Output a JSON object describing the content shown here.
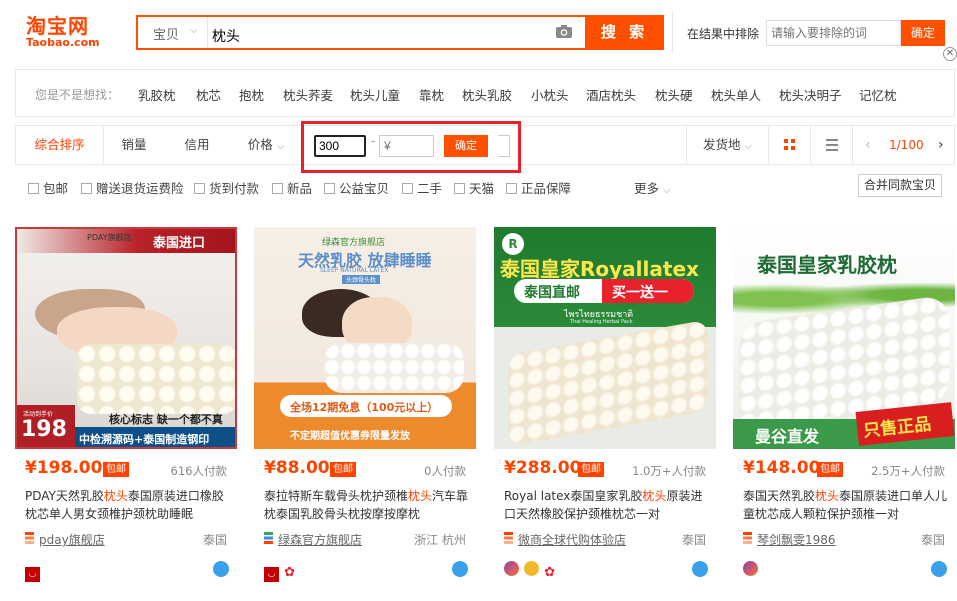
{
  "header": {
    "logo_cn": "淘宝网",
    "logo_en": "Taobao.com",
    "search_type": "宝贝",
    "search_query": "枕头",
    "search_button": "搜 索",
    "exclude_label": "在结果中排除",
    "exclude_placeholder": "请输入要排除的词",
    "exclude_button": "确定"
  },
  "suggestions": {
    "label": "您是不是想找：",
    "items": [
      "乳胶枕",
      "枕芯",
      "抱枕",
      "枕头荞麦",
      "枕头儿童",
      "靠枕",
      "枕头乳胶",
      "小枕头",
      "酒店枕头",
      "枕头硬",
      "枕头单人",
      "枕头决明子",
      "记忆枕"
    ]
  },
  "filter": {
    "sort_tabs": [
      "综合排序",
      "销量",
      "信用",
      "价格"
    ],
    "price_min": "300",
    "price_sep": "-",
    "price_max_placeholder": "¥",
    "price_confirm": "确定",
    "ship_from": "发货地",
    "page": "1/100",
    "checkboxes": [
      "包邮",
      "赠送退货运费险",
      "货到付款",
      "新品",
      "公益宝贝",
      "二手",
      "天猫",
      "正品保障"
    ],
    "more": "更多",
    "merge": "合并同款宝贝"
  },
  "colors": {
    "accent": "#ff4400",
    "brand": "#ff5000",
    "highlight": "#e8222c"
  },
  "products": [
    {
      "price": "¥198.00",
      "baoyou": "包邮",
      "sold": "616人付款",
      "title_pre": "PDAY天然乳胶",
      "title_hl": "枕头",
      "title_post": "泰国原装进口橡胶枕芯单人男女颈椎护颈枕助睡眠",
      "shop": "pday旗舰店",
      "location": "泰国",
      "img": {
        "banner": "泰国进口",
        "brand": "PDAY旗舰店",
        "slogan": "核心标志 缺一个都不真",
        "price_tag": "198",
        "price_label": "活动到手价",
        "footer": "中检溯源码+泰国制造钢印"
      }
    },
    {
      "price": "¥88.00",
      "baoyou": "包邮",
      "sold": "0人付款",
      "title_pre": "泰拉特斯车载骨头枕护颈椎",
      "title_hl": "枕头",
      "title_post": "汽车靠枕泰国乳胶骨头枕按摩按摩枕",
      "shop": "绿森官方旗舰店",
      "location": "浙江 杭州",
      "img": {
        "brand": "绿森官方旗舰店",
        "headline": "天然乳胶 放肆睡睡",
        "sub": "SLEEP NATURAL LATEX",
        "tag": "头颈骨头枕",
        "promo": "全场12期免息（100元以上）",
        "footer": "不定期超值优惠券限量发放"
      }
    },
    {
      "price": "¥288.00",
      "baoyou": "包邮",
      "sold": "1.0万+人付款",
      "title_pre": "Royal latex泰国皇家乳胶",
      "title_hl": "枕头",
      "title_post": "原装进口天然橡胶保护颈椎枕芯一对",
      "shop": "微商全球代购体验店",
      "location": "泰国",
      "img": {
        "headline": "泰国皇家Royallatex",
        "left": "泰国直邮",
        "right": "买一送一",
        "thai": "ไพรไทยธรรมชาติ",
        "thai_sub": "Thai Healing Herbal Pack"
      }
    },
    {
      "price": "¥148.00",
      "baoyou": "包邮",
      "sold": "2.5万+人付款",
      "title_pre": "泰国天然乳胶",
      "title_hl": "枕头",
      "title_post": "泰国原装进口单人儿童枕芯成人颗粒保护颈椎一对",
      "shop": "琴剑飘雯1986",
      "location": "泰国",
      "img": {
        "headline": "泰国皇家乳胶枕",
        "left": "曼谷直发",
        "right": "只售正品"
      }
    }
  ]
}
